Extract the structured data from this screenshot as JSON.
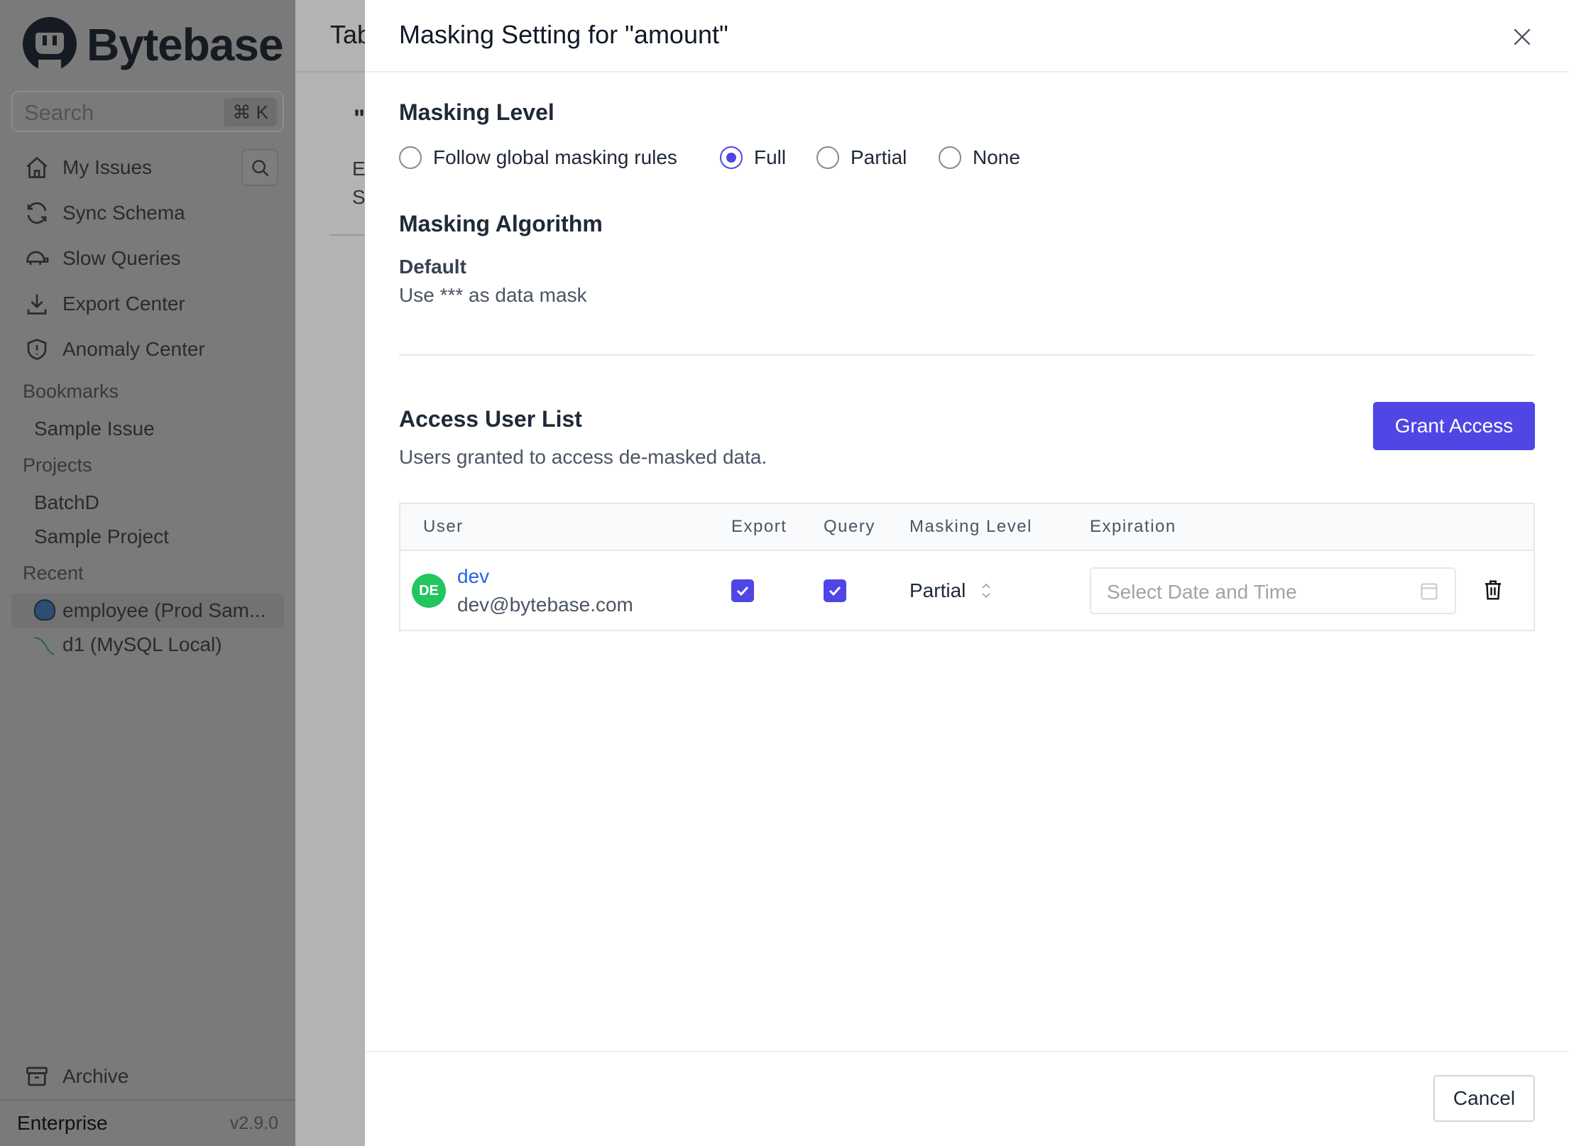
{
  "sidebar": {
    "brand": "Bytebase",
    "search": {
      "placeholder": "Search",
      "shortcut": "⌘ K"
    },
    "nav": [
      {
        "label": "My Issues",
        "icon": "home-icon"
      },
      {
        "label": "Sync Schema",
        "icon": "sync-icon"
      },
      {
        "label": "Slow Queries",
        "icon": "turtle-icon"
      },
      {
        "label": "Export Center",
        "icon": "download-icon"
      },
      {
        "label": "Anomaly Center",
        "icon": "shield-icon"
      }
    ],
    "bookmarks_label": "Bookmarks",
    "bookmarks": [
      "Sample Issue"
    ],
    "projects_label": "Projects",
    "projects": [
      "BatchD",
      "Sample Project"
    ],
    "recent_label": "Recent",
    "recent": [
      {
        "label": "employee (Prod Sam...",
        "icon": "postgresql-icon"
      },
      {
        "label": "d1 (MySQL Local)",
        "icon": "mysql-icon"
      }
    ],
    "archive": "Archive",
    "plan": "Enterprise",
    "version": "v2.9.0"
  },
  "background": {
    "title": "Tab",
    "quote": "\"",
    "line1": "E",
    "line2": "S"
  },
  "drawer": {
    "title": "Masking Setting for \"amount\"",
    "masking_level": {
      "heading": "Masking Level",
      "options": [
        "Follow global masking rules",
        "Full",
        "Partial",
        "None"
      ],
      "selected": "Full"
    },
    "algorithm": {
      "heading": "Masking Algorithm",
      "name": "Default",
      "description": "Use *** as data mask"
    },
    "access": {
      "heading": "Access User List",
      "subtitle": "Users granted to access de-masked data.",
      "grant_button": "Grant Access",
      "columns": [
        "User",
        "Export",
        "Query",
        "Masking Level",
        "Expiration"
      ],
      "rows": [
        {
          "initials": "DE",
          "name": "dev",
          "email": "dev@bytebase.com",
          "export": true,
          "query": true,
          "masking_level": "Partial",
          "expiration_placeholder": "Select Date and Time"
        }
      ]
    },
    "cancel": "Cancel"
  },
  "colors": {
    "accent": "#4f46e5",
    "avatar": "#22c55e",
    "link": "#2563eb"
  }
}
